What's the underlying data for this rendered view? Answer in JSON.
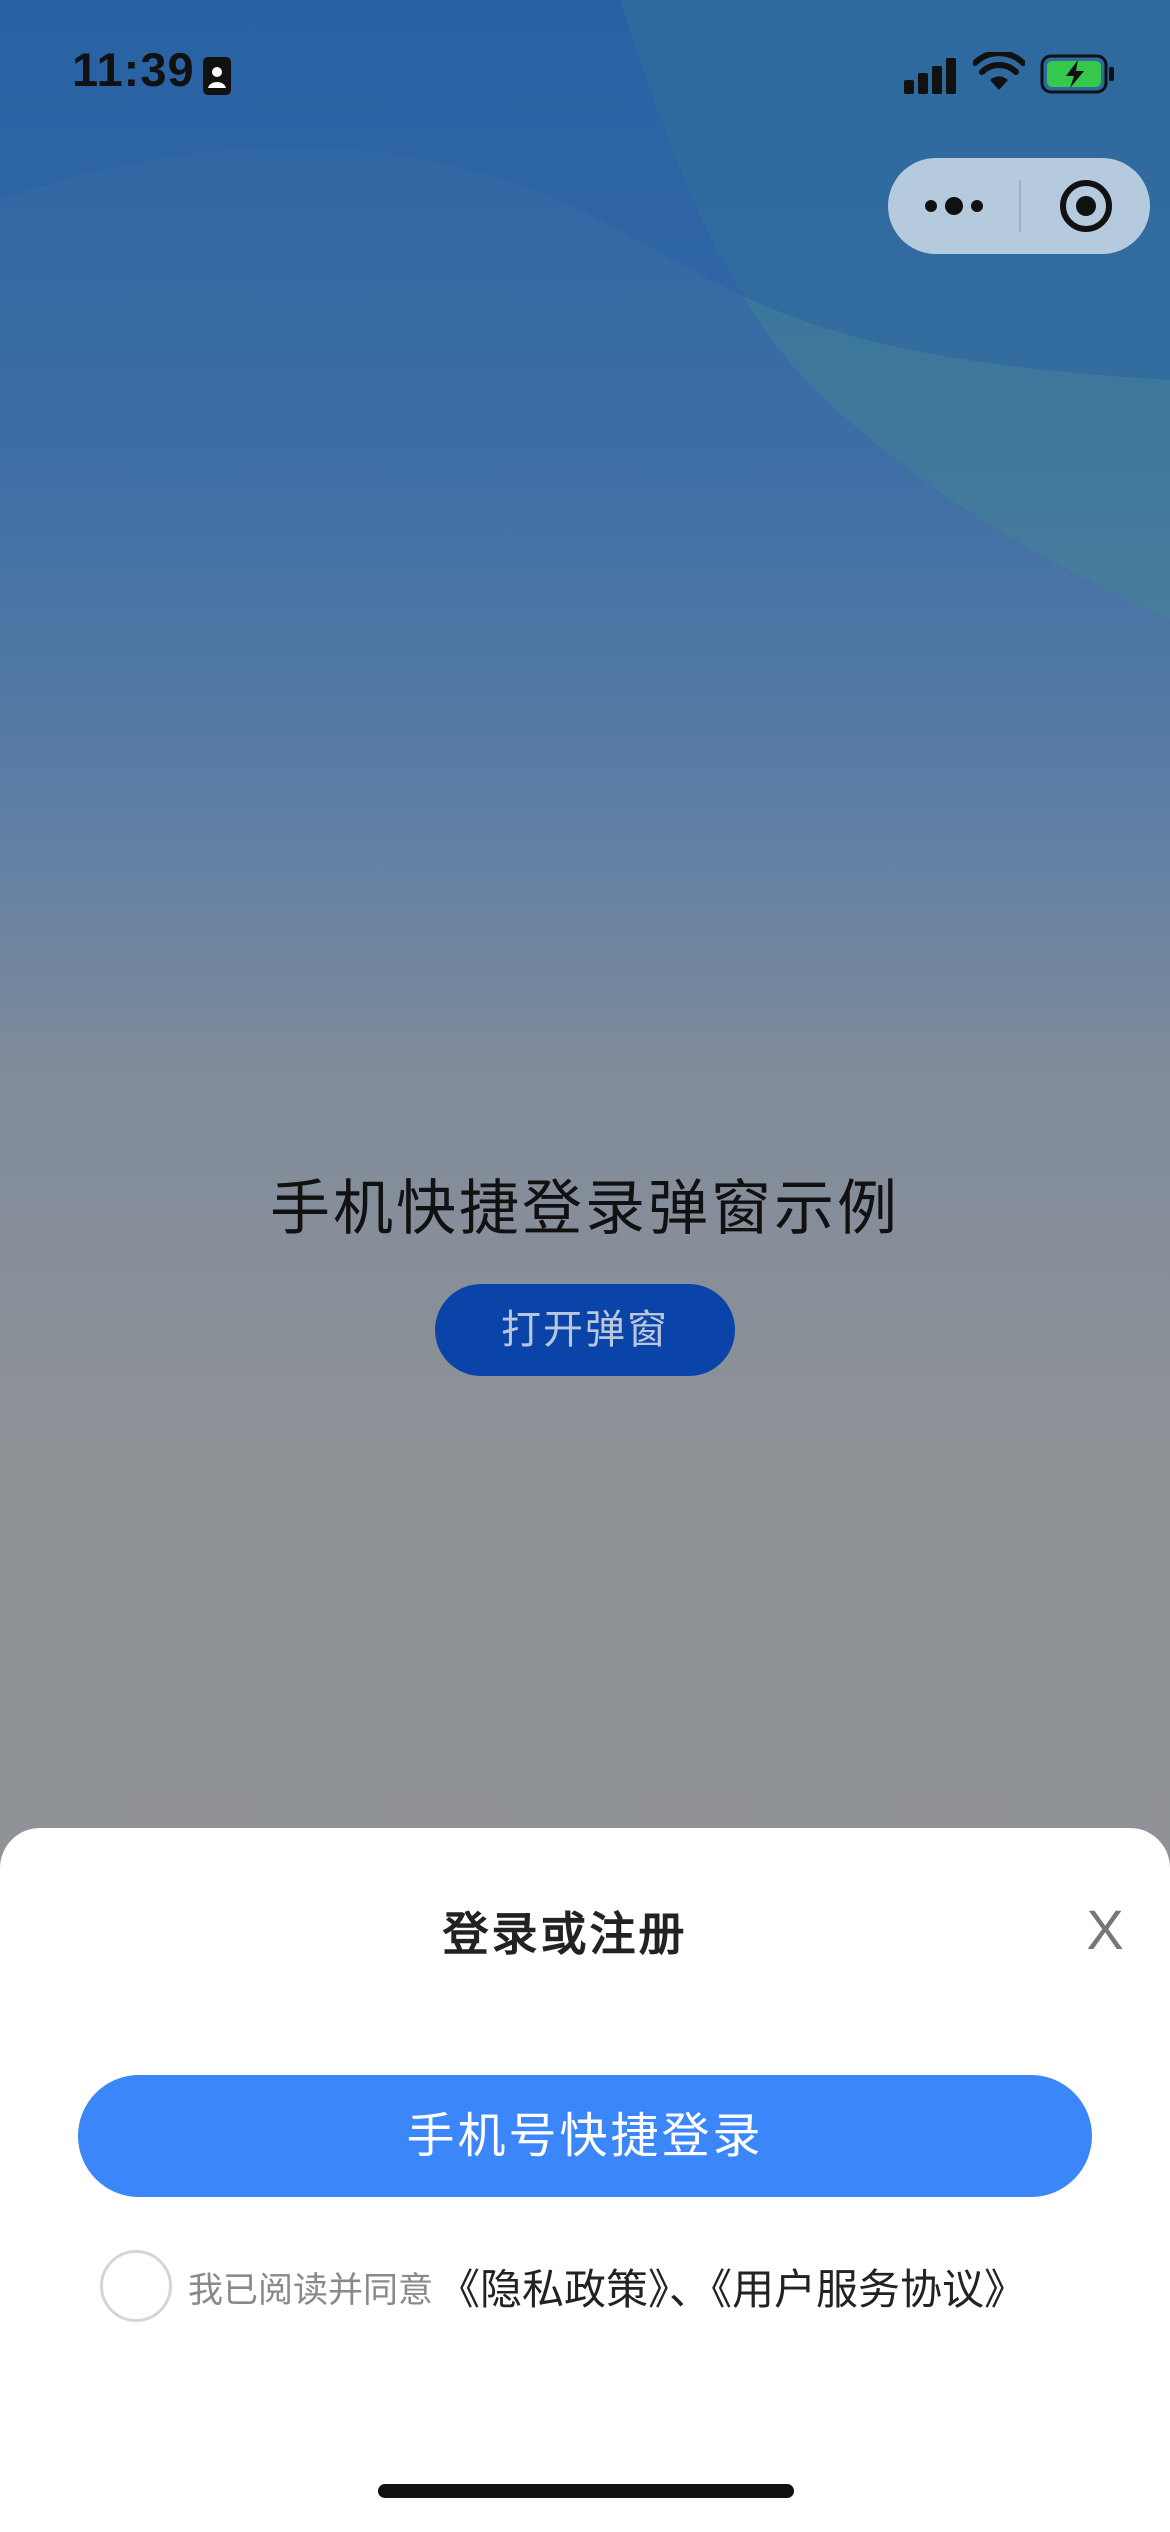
{
  "status_bar": {
    "time": "11:39",
    "icons": [
      "id-card-icon",
      "signal-icon",
      "wifi-icon",
      "battery-charging-icon"
    ]
  },
  "capsule": {
    "more_icon": "more-dots-icon",
    "close_icon": "target-circle-icon"
  },
  "main": {
    "title": "手机快捷登录弹窗示例",
    "open_button": "打开弹窗"
  },
  "sheet": {
    "title": "登录或注册",
    "close_label": "X",
    "login_button": "手机号快捷登录",
    "agree_text": "我已阅读并同意",
    "policy_links": "《隐私政策》、《用户服务协议》"
  },
  "colors": {
    "primary_button": "#3b86f8",
    "open_button": "#0b44a8",
    "sheet_bg": "#ffffff"
  }
}
